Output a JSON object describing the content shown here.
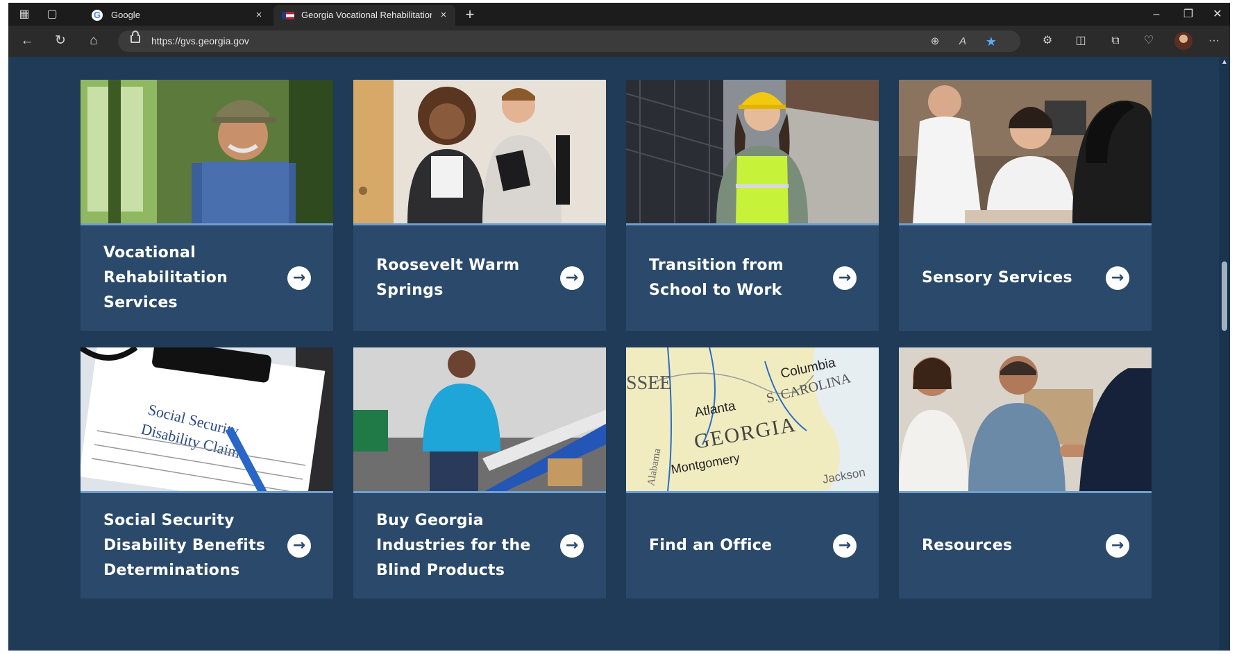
{
  "browser": {
    "tabs": [
      {
        "label": "Google",
        "favicon": "google-icon",
        "active": false
      },
      {
        "label": "Georgia Vocational Rehabilitation",
        "favicon": "georgia-flag-icon",
        "active": true
      }
    ],
    "address": {
      "url": "https://gvs.georgia.gov"
    },
    "glyphs": {
      "close": "×",
      "new_tab": "+",
      "back": "←",
      "refresh": "↻",
      "home": "⌂",
      "minimize": "–",
      "restore": "❐",
      "window_close": "✕",
      "more": "···",
      "zoom": "⊕",
      "read_aloud": "A",
      "favorite": "★",
      "extensions": "⚙",
      "split": "◫",
      "collections": "⧉",
      "browser_essentials": "♡",
      "workspaces": "▦",
      "tab_actions": "▢",
      "scroll_up": "▲",
      "google_g": "G"
    }
  },
  "colors": {
    "page_bg": "#1f3b57",
    "card_bg": "#2b4a6b",
    "accent_line": "#6f9fd0",
    "text": "#ffffff"
  },
  "cards": [
    {
      "label": "Vocational Rehabilitation Services",
      "arrow": "→",
      "image": "farmer-in-tractor"
    },
    {
      "label": "Roosevelt Warm Springs",
      "arrow": "→",
      "image": "two-students"
    },
    {
      "label": "Transition from School to Work",
      "arrow": "→",
      "image": "worker-in-safety-vest"
    },
    {
      "label": "Sensory Services",
      "arrow": "→",
      "image": "three-women-at-table"
    },
    {
      "label": "Social Security Disability Benefits Determinations",
      "arrow": "→",
      "image": "disability-claim-form",
      "image_text": {
        "line1": "Social Security",
        "line2": "Disability Claim"
      }
    },
    {
      "label": "Buy Georgia Industries for the Blind Products",
      "arrow": "→",
      "image": "factory-worker"
    },
    {
      "label": "Find an Office",
      "arrow": "→",
      "image": "georgia-map",
      "image_text": {
        "state": "GEORGIA",
        "city1": "Atlanta",
        "city2": "Montgomery",
        "city3": "Columbia",
        "city4": "Jackson",
        "neighbor1": "S. CAROLINA",
        "neighbor2": "SSEE",
        "neighbor3": "Alabama"
      }
    },
    {
      "label": "Resources",
      "arrow": "→",
      "image": "handshake-meeting"
    }
  ]
}
